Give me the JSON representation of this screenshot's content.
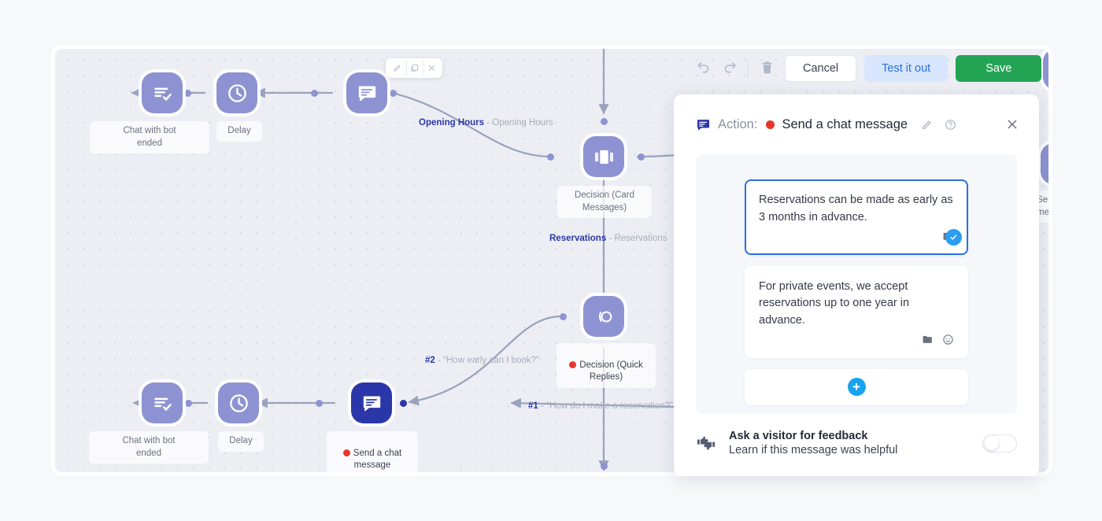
{
  "toolbar": {
    "undo_icon": "undo-icon",
    "redo_icon": "redo-icon",
    "delete_icon": "trash-icon",
    "cancel_label": "Cancel",
    "test_label": "Test it out",
    "save_label": "Save",
    "save_color": "#23a455",
    "test_color": "#d7e6fd"
  },
  "node_toolbar": {
    "edit_icon": "pencil-icon",
    "duplicate_icon": "copy-icon",
    "close_icon": "close-icon"
  },
  "canvas": {
    "nodes": [
      {
        "id": "n1",
        "label": "Chat with bot\nended",
        "icon": "chat-ended-icon",
        "selected": false,
        "has_dot": false
      },
      {
        "id": "n2",
        "label": "Delay",
        "icon": "clock-icon",
        "selected": false,
        "has_dot": false
      },
      {
        "id": "n3",
        "label": "",
        "icon": "chat-message-icon",
        "selected": false,
        "has_dot": false
      },
      {
        "id": "n4",
        "label": "Decision (Card\nMessages)",
        "icon": "card-carousel-icon",
        "selected": false,
        "has_dot": false
      },
      {
        "id": "n5",
        "label": "Decision (Quick\nReplies)",
        "icon": "quick-replies-icon",
        "selected": false,
        "has_dot": true
      },
      {
        "id": "n6",
        "label": "Chat with bot\nended",
        "icon": "chat-ended-icon",
        "selected": false,
        "has_dot": false
      },
      {
        "id": "n7",
        "label": "Delay",
        "icon": "clock-icon",
        "selected": false,
        "has_dot": false
      },
      {
        "id": "n8",
        "label": "Send a chat\nmessage",
        "icon": "chat-message-icon",
        "selected": true,
        "has_dot": true
      }
    ],
    "edge_labels": [
      {
        "id": "e1",
        "key": "Opening Hours",
        "sep": " - ",
        "value": "Opening Hours"
      },
      {
        "id": "e2",
        "key": "Reservations",
        "sep": " - ",
        "value": "Reservations"
      },
      {
        "id": "e3",
        "key": "#2",
        "sep": " - ",
        "value": "\"How early can I book?\""
      },
      {
        "id": "e4",
        "key": "#1",
        "sep": " - ",
        "value": "\"How do I make a reservation?\""
      }
    ],
    "clipped_node_label": "Send a chat\nmessage"
  },
  "panel": {
    "icon": "chat-message-icon",
    "kicker": "Action:",
    "title": "Send a chat message",
    "edit_icon": "pencil-icon",
    "help_icon": "question-circle-icon",
    "close_icon": "close-icon",
    "messages": [
      {
        "text": "Reservations can be made as early as 3 months in advance.",
        "active": true,
        "icons": [
          "folder-icon"
        ],
        "badge": "check-badge-icon"
      },
      {
        "text": "For private events, we accept reservations up to one year in advance.",
        "active": false,
        "icons": [
          "folder-icon",
          "emoji-icon"
        ],
        "badge": null
      }
    ],
    "add_label": "+",
    "feedback": {
      "icon": "thumbs-icon",
      "title": "Ask a visitor for feedback",
      "subtitle": "Learn if this message was helpful",
      "toggle_on": false
    }
  }
}
